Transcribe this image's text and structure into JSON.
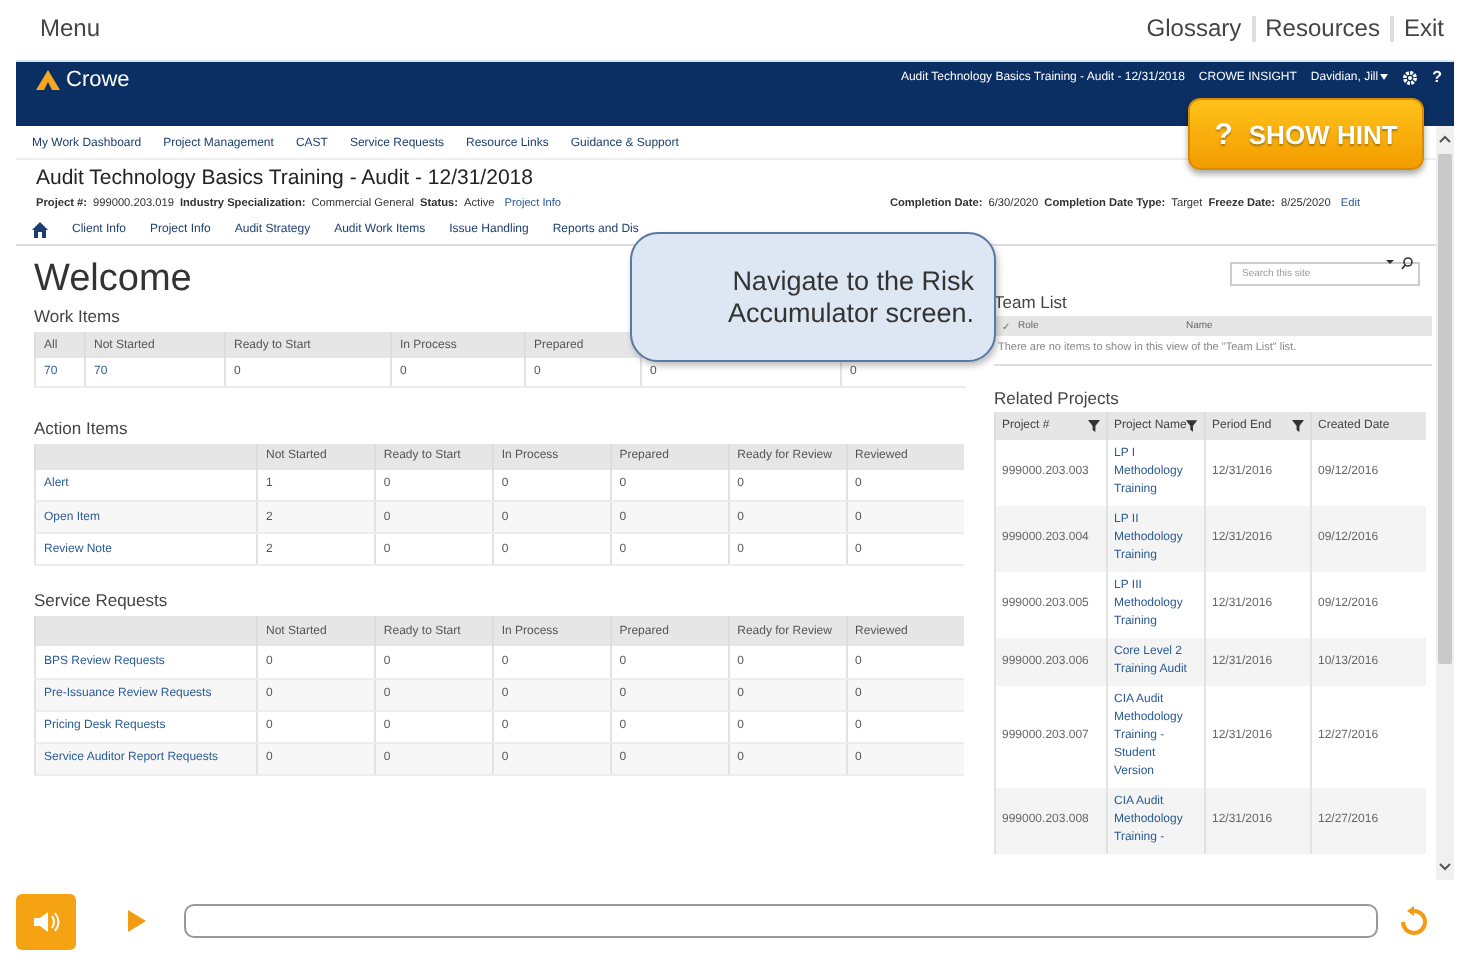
{
  "top_menu": {
    "menu": "Menu",
    "links": [
      "Glossary",
      "Resources",
      "Exit"
    ]
  },
  "header": {
    "logo": "Crowe",
    "context": "Audit Technology Basics Training - Audit - 12/31/2018",
    "product": "CROWE INSIGHT",
    "user": "Davidian, Jill",
    "help": "?"
  },
  "hint_button": {
    "icon": "?",
    "label": "SHOW HINT"
  },
  "nav_links": [
    "My Work Dashboard",
    "Project Management",
    "CAST",
    "Service Requests",
    "Resource Links",
    "Guidance & Support"
  ],
  "project": {
    "title": "Audit Technology Basics Training - Audit - 12/31/2018",
    "left_fields": [
      {
        "label": "Project #:",
        "value": "999000.203.019"
      },
      {
        "label": "Industry Specialization:",
        "value": "Commercial General"
      },
      {
        "label": "Status:",
        "value": "Active"
      }
    ],
    "left_link": "Project Info",
    "right_fields": [
      {
        "label": "Completion Date:",
        "value": "6/30/2020"
      },
      {
        "label": "Completion Date Type:",
        "value": "Target"
      },
      {
        "label": "Freeze Date:",
        "value": "8/25/2020"
      }
    ],
    "right_link": "Edit"
  },
  "tabs": [
    "Client Info",
    "Project Info",
    "Audit Strategy",
    "Audit Work Items",
    "Issue Handling",
    "Reports and Dis"
  ],
  "welcome": "Welcome",
  "search": {
    "placeholder": "Search this site"
  },
  "work_items": {
    "title": "Work Items",
    "columns": [
      "All",
      "Not Started",
      "Ready to Start",
      "In Process",
      "Prepared"
    ],
    "rows": [
      [
        "70",
        "70",
        "0",
        "0",
        "0",
        "0",
        "0"
      ]
    ]
  },
  "action_items": {
    "title": "Action Items",
    "columns": [
      "Not Started",
      "Ready to Start",
      "In Process",
      "Prepared",
      "Ready for Review",
      "Reviewed"
    ],
    "rows": [
      {
        "name": "Alert",
        "values": [
          "1",
          "0",
          "0",
          "0",
          "0",
          "0"
        ]
      },
      {
        "name": "Open Item",
        "values": [
          "2",
          "0",
          "0",
          "0",
          "0",
          "0"
        ]
      },
      {
        "name": "Review Note",
        "values": [
          "2",
          "0",
          "0",
          "0",
          "0",
          "0"
        ]
      }
    ]
  },
  "service_requests": {
    "title": "Service Requests",
    "columns": [
      "Not Started",
      "Ready to Start",
      "In Process",
      "Prepared",
      "Ready for Review",
      "Reviewed"
    ],
    "rows": [
      {
        "name": "BPS Review Requests",
        "values": [
          "0",
          "0",
          "0",
          "0",
          "0",
          "0"
        ]
      },
      {
        "name": "Pre-Issuance Review Requests",
        "values": [
          "0",
          "0",
          "0",
          "0",
          "0",
          "0"
        ]
      },
      {
        "name": "Pricing Desk Requests",
        "values": [
          "0",
          "0",
          "0",
          "0",
          "0",
          "0"
        ]
      },
      {
        "name": "Service Auditor Report Requests",
        "values": [
          "0",
          "0",
          "0",
          "0",
          "0",
          "0"
        ]
      }
    ]
  },
  "team_list": {
    "title": "Team List",
    "check": "✓",
    "columns": [
      "Role",
      "Name"
    ],
    "empty_message": "There are no items to show in this view of the \"Team List\" list."
  },
  "related_projects": {
    "title": "Related Projects",
    "columns": [
      "Project #",
      "Project Name",
      "Period End",
      "Created Date"
    ],
    "rows": [
      {
        "number": "999000.203.003",
        "name": "LP I Methodology Training",
        "period_end": "12/31/2016",
        "created": "09/12/2016"
      },
      {
        "number": "999000.203.004",
        "name": "LP II Methodology Training",
        "period_end": "12/31/2016",
        "created": "09/12/2016"
      },
      {
        "number": "999000.203.005",
        "name": "LP III Methodology Training",
        "period_end": "12/31/2016",
        "created": "09/12/2016"
      },
      {
        "number": "999000.203.006",
        "name": "Core Level 2 Training Audit",
        "period_end": "12/31/2016",
        "created": "10/13/2016"
      },
      {
        "number": "999000.203.007",
        "name": "CIA Audit Methodology Training - Student Version",
        "period_end": "12/31/2016",
        "created": "12/27/2016"
      },
      {
        "number": "999000.203.008",
        "name": "CIA Audit Methodology Training -",
        "period_end": "12/31/2016",
        "created": "12/27/2016"
      }
    ]
  },
  "callout": "Navigate to the Risk Accumulator screen."
}
